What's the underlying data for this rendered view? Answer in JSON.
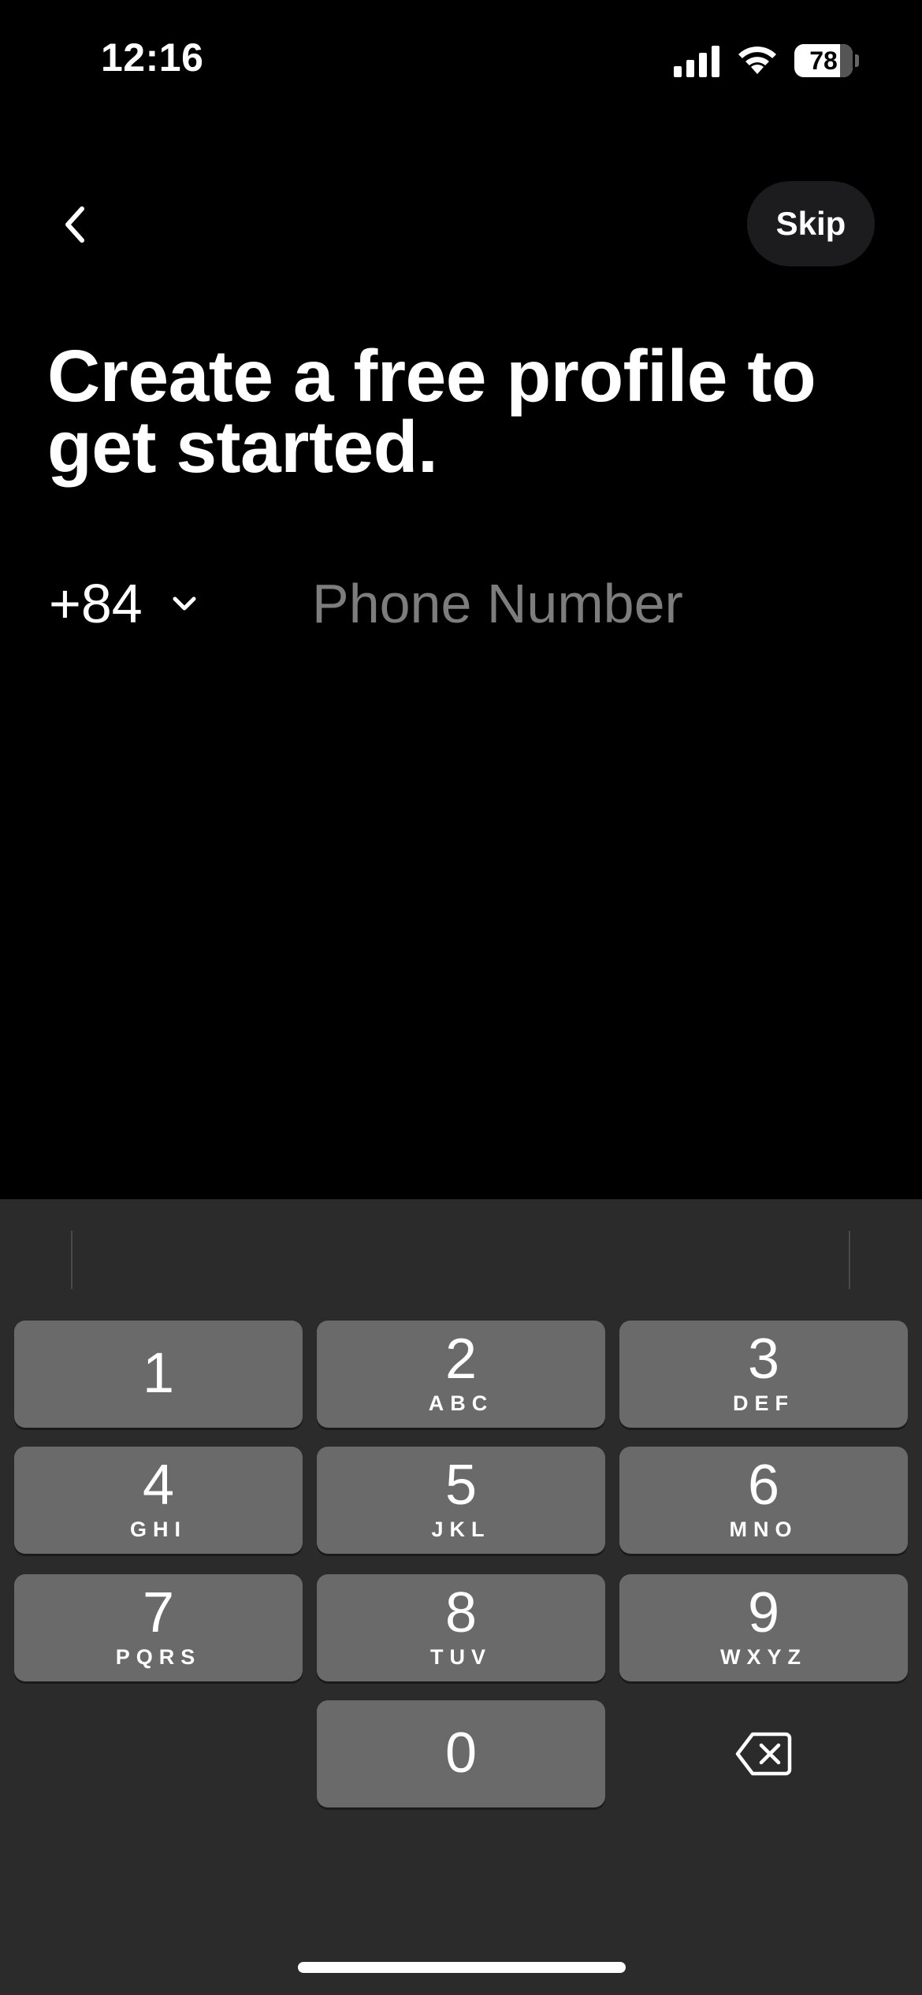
{
  "status_bar": {
    "time": "12:16",
    "battery_level": "78",
    "battery_fraction": 0.78,
    "signal_icon": "cellular-signal-icon",
    "wifi_icon": "wifi-icon"
  },
  "nav": {
    "back_icon": "chevron-left-icon",
    "skip_label": "Skip"
  },
  "title": "Create a free profile to get started.",
  "phone": {
    "country_code": "+84",
    "placeholder": "Phone Number",
    "value": ""
  },
  "keypad": {
    "keys": [
      {
        "digit": "1",
        "letters": ""
      },
      {
        "digit": "2",
        "letters": "ABC"
      },
      {
        "digit": "3",
        "letters": "DEF"
      },
      {
        "digit": "4",
        "letters": "GHI"
      },
      {
        "digit": "5",
        "letters": "JKL"
      },
      {
        "digit": "6",
        "letters": "MNO"
      },
      {
        "digit": "7",
        "letters": "PQRS"
      },
      {
        "digit": "8",
        "letters": "TUV"
      },
      {
        "digit": "9",
        "letters": "WXYZ"
      },
      {
        "digit": "0",
        "letters": ""
      }
    ],
    "delete_icon": "backspace-icon"
  },
  "colors": {
    "background": "#000000",
    "keyboard_background": "#2b2b2b",
    "key_background": "#6a6a6a",
    "skip_button_background": "#1c1c1e",
    "placeholder_text": "#7d7d7d"
  }
}
